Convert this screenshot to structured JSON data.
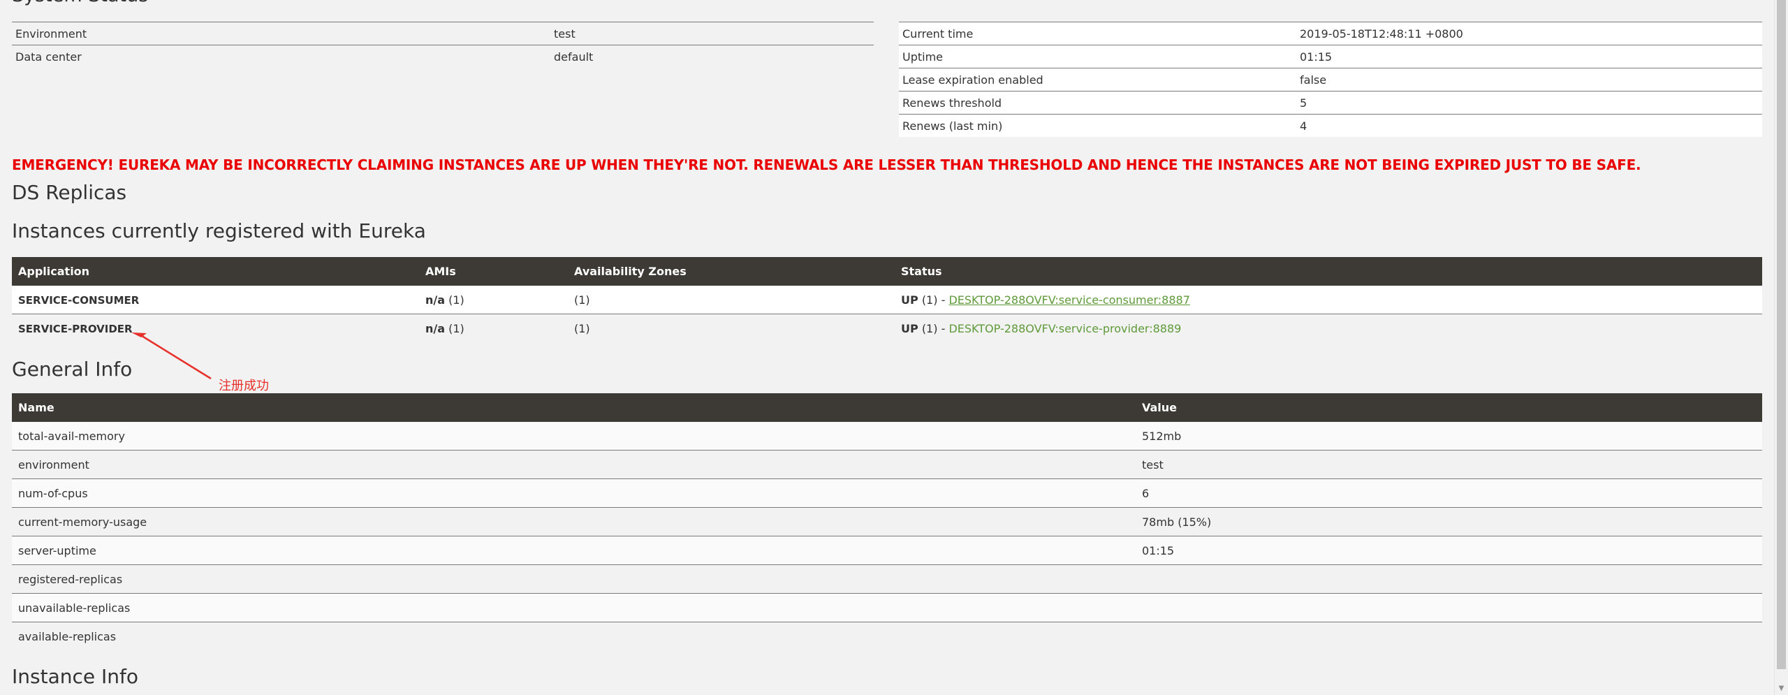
{
  "headings": {
    "system_status": "System Status",
    "ds_replicas": "DS Replicas",
    "instances": "Instances currently registered with Eureka",
    "general_info": "General Info",
    "instance_info": "Instance Info"
  },
  "status_left": [
    {
      "key": "Environment",
      "value": "test"
    },
    {
      "key": "Data center",
      "value": "default"
    }
  ],
  "status_right": [
    {
      "key": "Current time",
      "value": "2019-05-18T12:48:11 +0800"
    },
    {
      "key": "Uptime",
      "value": "01:15"
    },
    {
      "key": "Lease expiration enabled",
      "value": "false"
    },
    {
      "key": "Renews threshold",
      "value": "5"
    },
    {
      "key": "Renews (last min)",
      "value": "4"
    }
  ],
  "emergency": "EMERGENCY! EUREKA MAY BE INCORRECTLY CLAIMING INSTANCES ARE UP WHEN THEY'RE NOT. RENEWALS ARE LESSER THAN THRESHOLD AND HENCE THE INSTANCES ARE NOT BEING EXPIRED JUST TO BE SAFE.",
  "instances": {
    "columns": [
      "Application",
      "AMIs",
      "Availability Zones",
      "Status"
    ],
    "rows": [
      {
        "application": "SERVICE-CONSUMER",
        "ami_value": "n/a",
        "ami_count": "(1)",
        "zones": "(1)",
        "status": "UP",
        "status_count": "(1) -",
        "link": "DESKTOP-288OVFV:service-consumer:8887"
      },
      {
        "application": "SERVICE-PROVIDER",
        "ami_value": "n/a",
        "ami_count": "(1)",
        "zones": "(1)",
        "status": "UP",
        "status_count": "(1) -",
        "link": "DESKTOP-288OVFV:service-provider:8889"
      }
    ]
  },
  "general_info": {
    "columns": [
      "Name",
      "Value"
    ],
    "rows": [
      {
        "name": "total-avail-memory",
        "value": "512mb"
      },
      {
        "name": "environment",
        "value": "test"
      },
      {
        "name": "num-of-cpus",
        "value": "6"
      },
      {
        "name": "current-memory-usage",
        "value": "78mb (15%)"
      },
      {
        "name": "server-uptime",
        "value": "01:15"
      },
      {
        "name": "registered-replicas",
        "value": ""
      },
      {
        "name": "unavailable-replicas",
        "value": ""
      },
      {
        "name": "available-replicas",
        "value": ""
      }
    ]
  },
  "annotation": {
    "text": "注册成功",
    "color": "#e8302a"
  },
  "colors": {
    "header_bg": "#3d3935",
    "emergency": "#ea0000",
    "link": "#5f9a3a",
    "page_bg": "#f2f2f2"
  }
}
